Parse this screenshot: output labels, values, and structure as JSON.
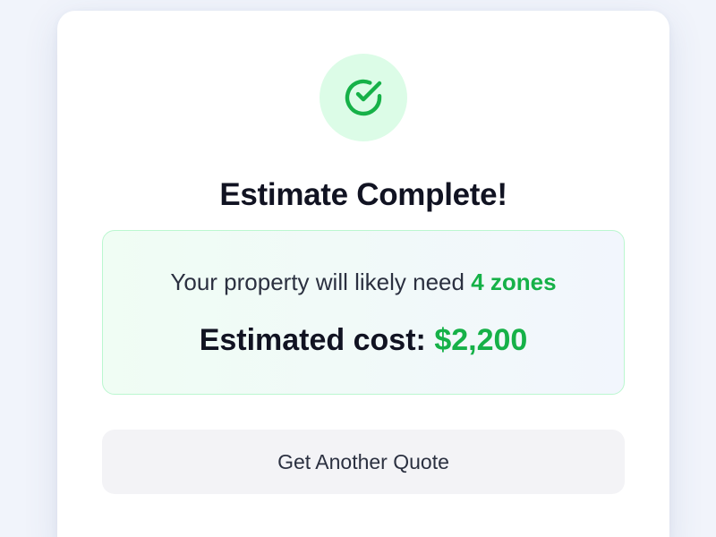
{
  "result": {
    "title": "Estimate Complete!",
    "zones_prefix": "Your property will likely need ",
    "zones_value": "4 zones",
    "cost_label": "Estimated cost: ",
    "cost_value": "$2,200"
  },
  "actions": {
    "another_quote_label": "Get Another Quote"
  },
  "icons": {
    "status": "check-circle-icon"
  },
  "colors": {
    "accent_green": "#16b148",
    "icon_background": "#dcfce7",
    "box_border": "#bbf7d0",
    "heading_text": "#111322",
    "button_background": "#f3f3f6"
  }
}
